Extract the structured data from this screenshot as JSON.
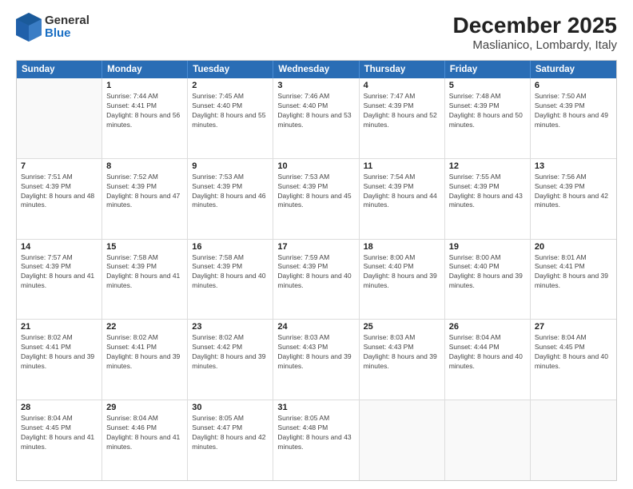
{
  "logo": {
    "general": "General",
    "blue": "Blue"
  },
  "title": "December 2025",
  "subtitle": "Maslianico, Lombardy, Italy",
  "header_days": [
    "Sunday",
    "Monday",
    "Tuesday",
    "Wednesday",
    "Thursday",
    "Friday",
    "Saturday"
  ],
  "weeks": [
    [
      {
        "day": "",
        "sunrise": "",
        "sunset": "",
        "daylight": ""
      },
      {
        "day": "1",
        "sunrise": "Sunrise: 7:44 AM",
        "sunset": "Sunset: 4:41 PM",
        "daylight": "Daylight: 8 hours and 56 minutes."
      },
      {
        "day": "2",
        "sunrise": "Sunrise: 7:45 AM",
        "sunset": "Sunset: 4:40 PM",
        "daylight": "Daylight: 8 hours and 55 minutes."
      },
      {
        "day": "3",
        "sunrise": "Sunrise: 7:46 AM",
        "sunset": "Sunset: 4:40 PM",
        "daylight": "Daylight: 8 hours and 53 minutes."
      },
      {
        "day": "4",
        "sunrise": "Sunrise: 7:47 AM",
        "sunset": "Sunset: 4:39 PM",
        "daylight": "Daylight: 8 hours and 52 minutes."
      },
      {
        "day": "5",
        "sunrise": "Sunrise: 7:48 AM",
        "sunset": "Sunset: 4:39 PM",
        "daylight": "Daylight: 8 hours and 50 minutes."
      },
      {
        "day": "6",
        "sunrise": "Sunrise: 7:50 AM",
        "sunset": "Sunset: 4:39 PM",
        "daylight": "Daylight: 8 hours and 49 minutes."
      }
    ],
    [
      {
        "day": "7",
        "sunrise": "Sunrise: 7:51 AM",
        "sunset": "Sunset: 4:39 PM",
        "daylight": "Daylight: 8 hours and 48 minutes."
      },
      {
        "day": "8",
        "sunrise": "Sunrise: 7:52 AM",
        "sunset": "Sunset: 4:39 PM",
        "daylight": "Daylight: 8 hours and 47 minutes."
      },
      {
        "day": "9",
        "sunrise": "Sunrise: 7:53 AM",
        "sunset": "Sunset: 4:39 PM",
        "daylight": "Daylight: 8 hours and 46 minutes."
      },
      {
        "day": "10",
        "sunrise": "Sunrise: 7:53 AM",
        "sunset": "Sunset: 4:39 PM",
        "daylight": "Daylight: 8 hours and 45 minutes."
      },
      {
        "day": "11",
        "sunrise": "Sunrise: 7:54 AM",
        "sunset": "Sunset: 4:39 PM",
        "daylight": "Daylight: 8 hours and 44 minutes."
      },
      {
        "day": "12",
        "sunrise": "Sunrise: 7:55 AM",
        "sunset": "Sunset: 4:39 PM",
        "daylight": "Daylight: 8 hours and 43 minutes."
      },
      {
        "day": "13",
        "sunrise": "Sunrise: 7:56 AM",
        "sunset": "Sunset: 4:39 PM",
        "daylight": "Daylight: 8 hours and 42 minutes."
      }
    ],
    [
      {
        "day": "14",
        "sunrise": "Sunrise: 7:57 AM",
        "sunset": "Sunset: 4:39 PM",
        "daylight": "Daylight: 8 hours and 41 minutes."
      },
      {
        "day": "15",
        "sunrise": "Sunrise: 7:58 AM",
        "sunset": "Sunset: 4:39 PM",
        "daylight": "Daylight: 8 hours and 41 minutes."
      },
      {
        "day": "16",
        "sunrise": "Sunrise: 7:58 AM",
        "sunset": "Sunset: 4:39 PM",
        "daylight": "Daylight: 8 hours and 40 minutes."
      },
      {
        "day": "17",
        "sunrise": "Sunrise: 7:59 AM",
        "sunset": "Sunset: 4:39 PM",
        "daylight": "Daylight: 8 hours and 40 minutes."
      },
      {
        "day": "18",
        "sunrise": "Sunrise: 8:00 AM",
        "sunset": "Sunset: 4:40 PM",
        "daylight": "Daylight: 8 hours and 39 minutes."
      },
      {
        "day": "19",
        "sunrise": "Sunrise: 8:00 AM",
        "sunset": "Sunset: 4:40 PM",
        "daylight": "Daylight: 8 hours and 39 minutes."
      },
      {
        "day": "20",
        "sunrise": "Sunrise: 8:01 AM",
        "sunset": "Sunset: 4:41 PM",
        "daylight": "Daylight: 8 hours and 39 minutes."
      }
    ],
    [
      {
        "day": "21",
        "sunrise": "Sunrise: 8:02 AM",
        "sunset": "Sunset: 4:41 PM",
        "daylight": "Daylight: 8 hours and 39 minutes."
      },
      {
        "day": "22",
        "sunrise": "Sunrise: 8:02 AM",
        "sunset": "Sunset: 4:41 PM",
        "daylight": "Daylight: 8 hours and 39 minutes."
      },
      {
        "day": "23",
        "sunrise": "Sunrise: 8:02 AM",
        "sunset": "Sunset: 4:42 PM",
        "daylight": "Daylight: 8 hours and 39 minutes."
      },
      {
        "day": "24",
        "sunrise": "Sunrise: 8:03 AM",
        "sunset": "Sunset: 4:43 PM",
        "daylight": "Daylight: 8 hours and 39 minutes."
      },
      {
        "day": "25",
        "sunrise": "Sunrise: 8:03 AM",
        "sunset": "Sunset: 4:43 PM",
        "daylight": "Daylight: 8 hours and 39 minutes."
      },
      {
        "day": "26",
        "sunrise": "Sunrise: 8:04 AM",
        "sunset": "Sunset: 4:44 PM",
        "daylight": "Daylight: 8 hours and 40 minutes."
      },
      {
        "day": "27",
        "sunrise": "Sunrise: 8:04 AM",
        "sunset": "Sunset: 4:45 PM",
        "daylight": "Daylight: 8 hours and 40 minutes."
      }
    ],
    [
      {
        "day": "28",
        "sunrise": "Sunrise: 8:04 AM",
        "sunset": "Sunset: 4:45 PM",
        "daylight": "Daylight: 8 hours and 41 minutes."
      },
      {
        "day": "29",
        "sunrise": "Sunrise: 8:04 AM",
        "sunset": "Sunset: 4:46 PM",
        "daylight": "Daylight: 8 hours and 41 minutes."
      },
      {
        "day": "30",
        "sunrise": "Sunrise: 8:05 AM",
        "sunset": "Sunset: 4:47 PM",
        "daylight": "Daylight: 8 hours and 42 minutes."
      },
      {
        "day": "31",
        "sunrise": "Sunrise: 8:05 AM",
        "sunset": "Sunset: 4:48 PM",
        "daylight": "Daylight: 8 hours and 43 minutes."
      },
      {
        "day": "",
        "sunrise": "",
        "sunset": "",
        "daylight": ""
      },
      {
        "day": "",
        "sunrise": "",
        "sunset": "",
        "daylight": ""
      },
      {
        "day": "",
        "sunrise": "",
        "sunset": "",
        "daylight": ""
      }
    ]
  ]
}
